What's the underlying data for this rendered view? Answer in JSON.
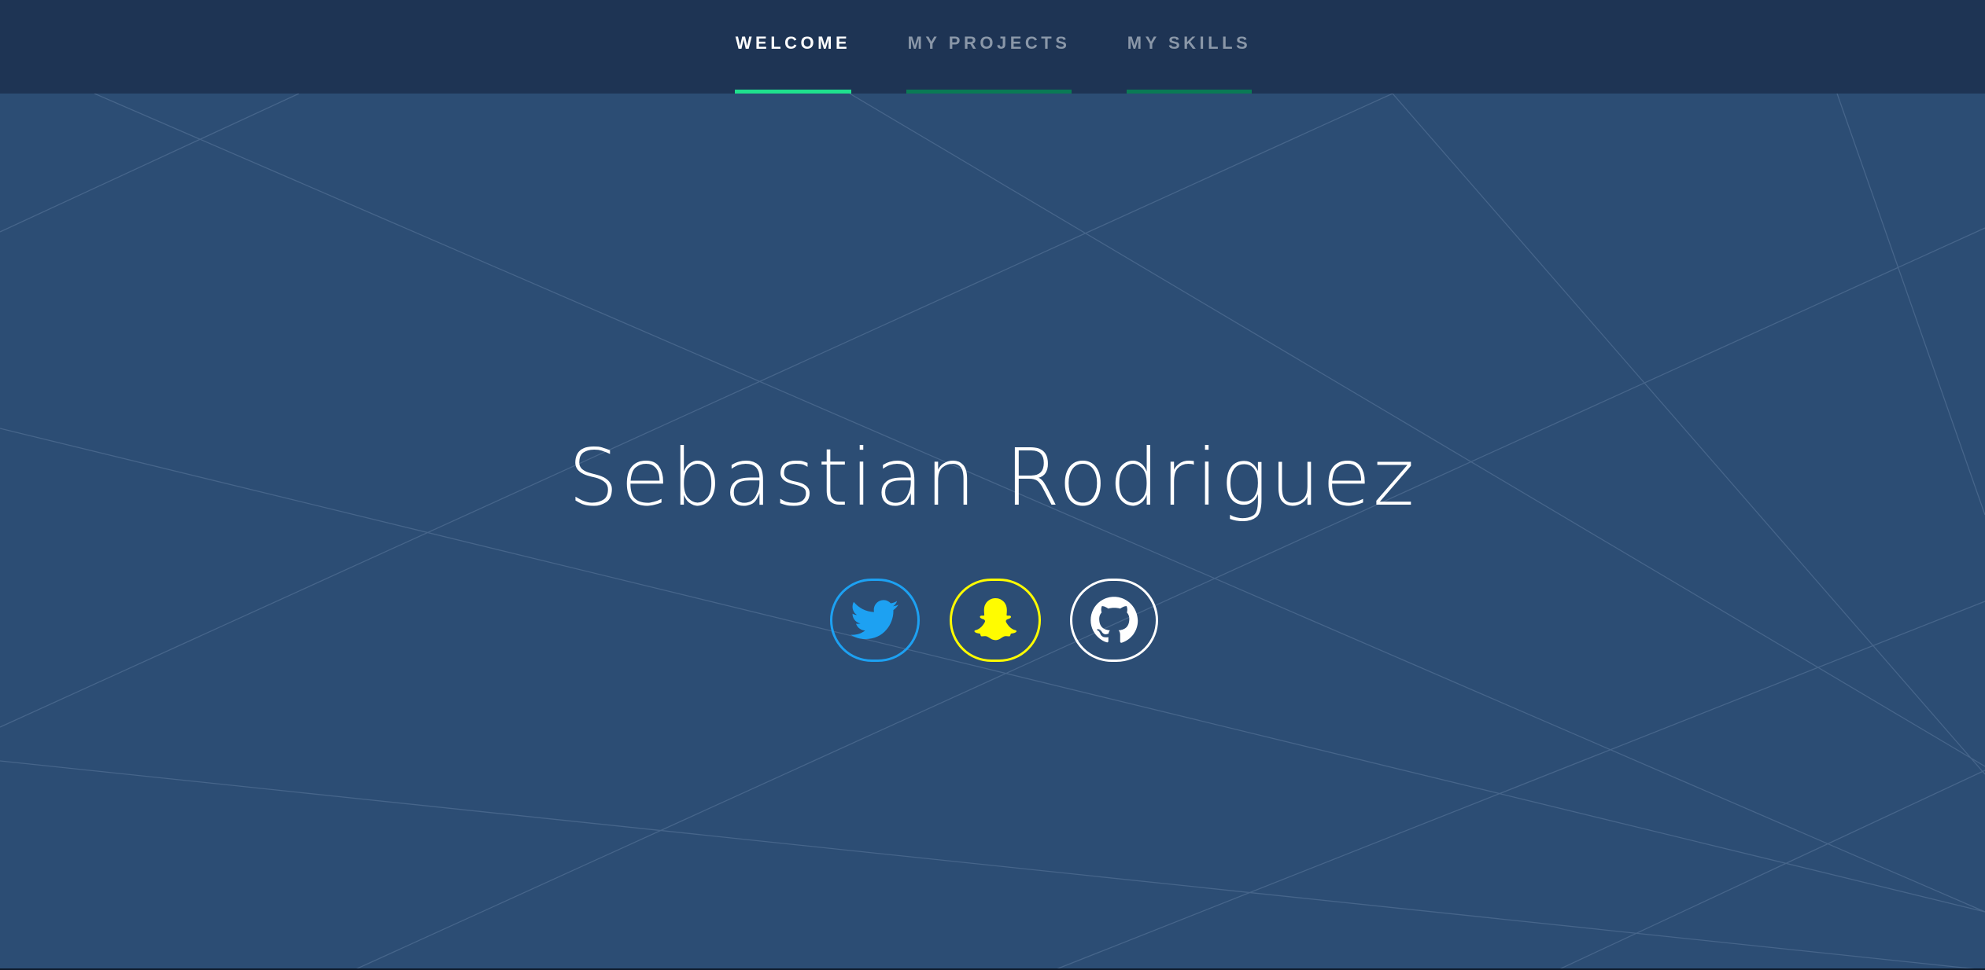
{
  "nav": {
    "tabs": [
      {
        "label": "WELCOME",
        "active": true
      },
      {
        "label": "MY PROJECTS",
        "active": false
      },
      {
        "label": "MY SKILLS",
        "active": false
      }
    ]
  },
  "hero": {
    "name": "Sebastian Rodriguez"
  },
  "social": [
    {
      "icon": "twitter-icon",
      "color": "#1da1f2"
    },
    {
      "icon": "snapchat-icon",
      "color": "#fffc00"
    },
    {
      "icon": "github-icon",
      "color": "#ffffff"
    }
  ],
  "colors": {
    "background": "#2c4d74",
    "navbar": "#1e3454",
    "accent_active": "#1fe08e",
    "accent_inactive": "#0a7a55"
  }
}
